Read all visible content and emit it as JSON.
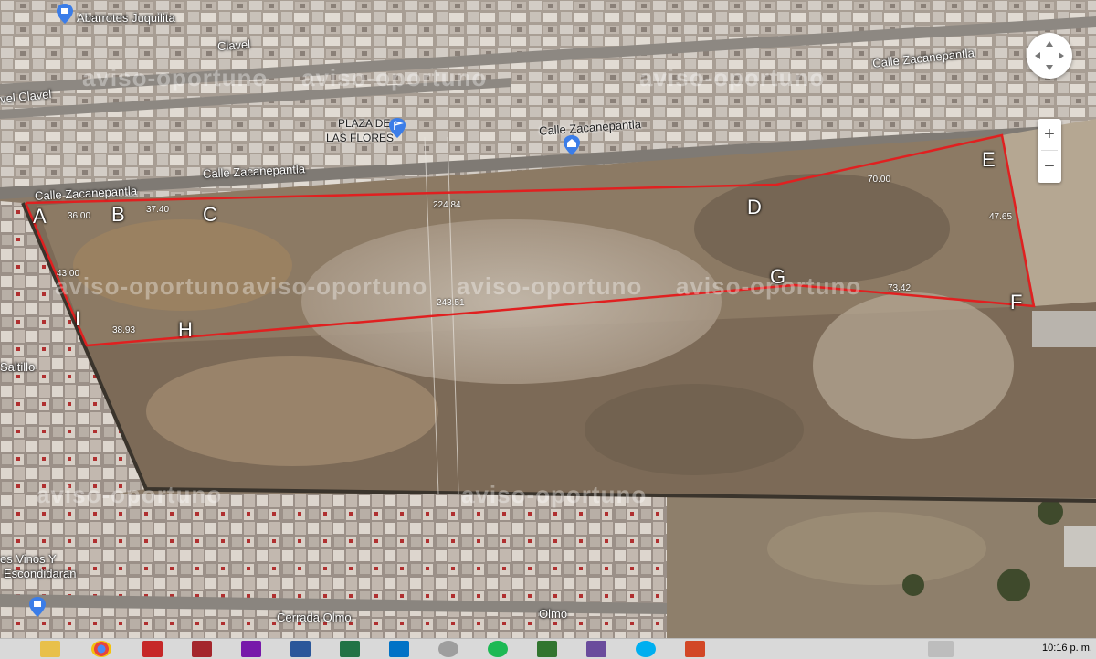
{
  "streets": {
    "abarrotes": "Abarrotes Juquilita",
    "clavel_top": "Clavel",
    "clavel_left": "vel Clavel",
    "plaza_line1": "PLAZA DE",
    "plaza_line2": "LAS FLORES",
    "zacanepantla_right": "Calle Zacanepantla",
    "zacanepantla_mid": "Calle Zacanepantla",
    "zacanepantla_left1": "Calle Zacanepantla",
    "zacanepantla_left2": "Calle Zacanepantla",
    "saltillo": "Saltillo",
    "vinos_line1": "es Vinos Y",
    "vinos_line2": "Escondidaran",
    "cerrada_olmo": "Cerrada Olmo",
    "olmo": "Olmo"
  },
  "vertices": {
    "A": "A",
    "B": "B",
    "C": "C",
    "D": "D",
    "E": "E",
    "F": "F",
    "G": "G",
    "H": "H",
    "I": "I"
  },
  "measurements": {
    "m1": "36.00",
    "m2": "37.40",
    "m3": "224.84",
    "m4": "70.00",
    "m5": "47.65",
    "m6": "43.00",
    "m7": "243.51",
    "m8": "73.42",
    "m9": "38.93"
  },
  "watermark": "aviso-oportuno",
  "controls": {
    "zoom_in": "+",
    "zoom_out": "−"
  },
  "taskbar": {
    "clock": "10:16 p. m."
  },
  "colors": {
    "boundary": "#e02020",
    "pin": "#3b7de8"
  },
  "icons": [
    "compass-icon",
    "zoom-in-icon",
    "zoom-out-icon",
    "location-pin-icon",
    "file-explorer-icon",
    "chrome-icon",
    "acrobat-icon",
    "access-icon",
    "onenote-icon",
    "word-icon",
    "excel-icon",
    "outlook-icon",
    "spotify-icon",
    "project-icon",
    "teams-icon",
    "skype-icon",
    "powerpoint-icon"
  ]
}
